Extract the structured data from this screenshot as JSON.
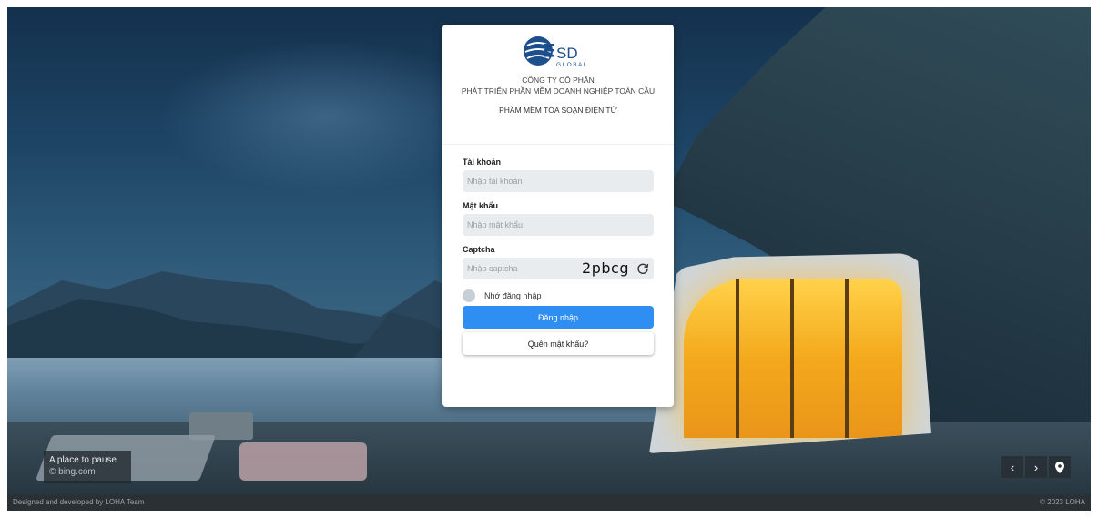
{
  "company": {
    "logo_text": "SD",
    "logo_sub": "GLOBAL",
    "line1": "CÔNG TY CỔ PHẦN",
    "line2": "PHÁT TRIỂN PHẦN MỀM DOANH NGHIỆP TOÀN CẦU",
    "product": "PHẦM MỀM TÒA SOẠN ĐIỆN TỬ"
  },
  "form": {
    "username_label": "Tài khoản",
    "username_placeholder": "Nhập tài khoản",
    "password_label": "Mật khẩu",
    "password_placeholder": "Nhập mật khẩu",
    "captcha_label": "Captcha",
    "captcha_placeholder": "Nhập captcha",
    "captcha_code": "2pbcg",
    "remember_label": "Nhớ đăng nhập",
    "login_button": "Đăng nhập",
    "forgot_button": "Quên mật khẩu?"
  },
  "background": {
    "caption_title": "A place to pause",
    "caption_source": "© bing.com"
  },
  "footer": {
    "left": "Designed and developed by LOHA Team",
    "right": "© 2023 LOHA"
  },
  "icons": {
    "prev": "chevron-left-icon",
    "next": "chevron-right-icon",
    "location": "map-pin-icon",
    "refresh": "refresh-icon"
  },
  "colors": {
    "primary": "#2f8ef2",
    "logo_blue": "#1d4f8c"
  }
}
